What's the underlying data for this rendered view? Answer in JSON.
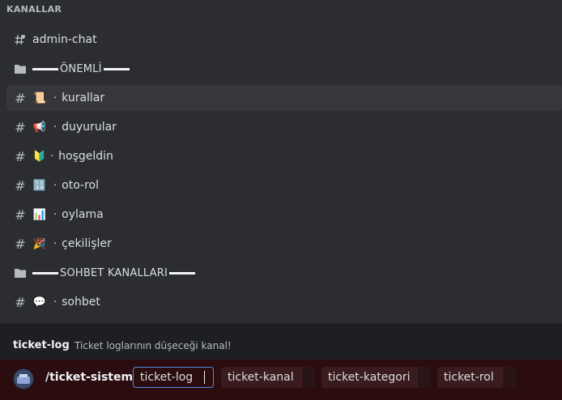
{
  "section_title": "KANALLAR",
  "channels": [
    {
      "kind": "channel",
      "name": "admin-chat",
      "emoji": "",
      "icon": "hash-lock-icon",
      "selected": false
    },
    {
      "kind": "category",
      "name": "ÖNEMLİ",
      "icon": "folder-icon"
    },
    {
      "kind": "channel",
      "name": "kurallar",
      "emoji": "📜",
      "icon": "hash-icon",
      "selected": true
    },
    {
      "kind": "channel",
      "name": "duyurular",
      "emoji": "📢",
      "icon": "hash-icon",
      "selected": false
    },
    {
      "kind": "channel",
      "name": "hoşgeldin",
      "emoji": "🔰",
      "icon": "hash-icon",
      "selected": false
    },
    {
      "kind": "channel",
      "name": "oto-rol",
      "emoji": "🔢",
      "icon": "hash-icon",
      "selected": false
    },
    {
      "kind": "channel",
      "name": "oylama",
      "emoji": "📊",
      "icon": "hash-icon",
      "selected": false
    },
    {
      "kind": "channel",
      "name": "çekilişler",
      "emoji": "🎉",
      "icon": "hash-icon",
      "selected": false
    },
    {
      "kind": "category",
      "name": "SOHBET KANALLARI",
      "icon": "folder-icon"
    },
    {
      "kind": "channel",
      "name": "sohbet",
      "emoji": "💬",
      "icon": "hash-icon",
      "selected": false
    }
  ],
  "hint": {
    "option_name": "ticket-log",
    "description": "Ticket loglarının düşeceği kanal!"
  },
  "command": {
    "name": "/ticket-sistemi",
    "options": [
      "ticket-log",
      "ticket-kanal",
      "ticket-kategori",
      "ticket-rol"
    ],
    "active_option": "ticket-log"
  },
  "colors": {
    "popup_bg": "#2b2d31",
    "selected_row": "#35373c",
    "command_bar": "#2b0d0f",
    "focus_border": "#5b86e5"
  }
}
